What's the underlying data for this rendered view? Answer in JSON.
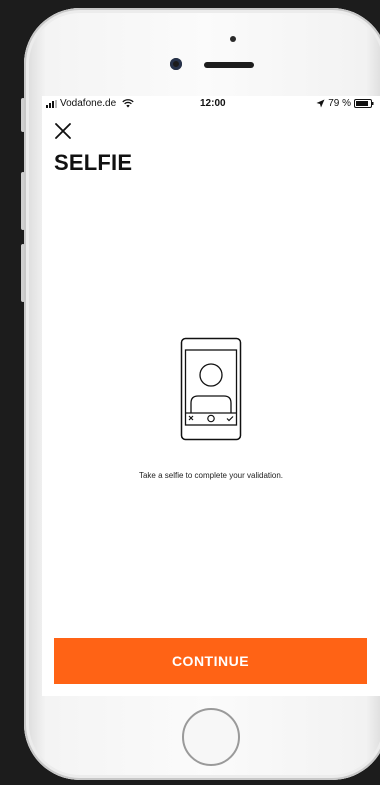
{
  "status_bar": {
    "carrier": "Vodafone.de",
    "time": "12:00",
    "battery": "79 %"
  },
  "header": {
    "title": "SELFIE",
    "close_icon": "close-icon"
  },
  "content": {
    "illustration_icon": "phone-selfie-icon",
    "message": "Take a selfie to complete your validation."
  },
  "footer": {
    "continue_label": "CONTINUE"
  },
  "colors": {
    "accent": "#ff6315",
    "text": "#111111",
    "screen_background": "#ffffff"
  }
}
